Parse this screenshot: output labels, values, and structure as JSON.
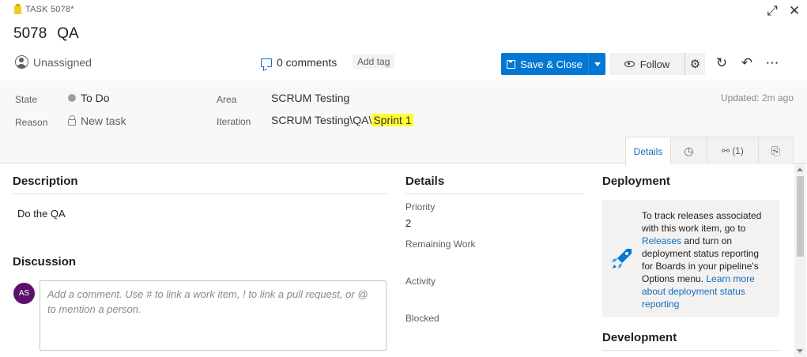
{
  "header": {
    "work_item_type": "TASK 5078*",
    "id": "5078",
    "title": "QA",
    "assignee": "Unassigned",
    "comments_label": "0 comments",
    "add_tag_label": "Add tag",
    "save_label": "Save & Close",
    "follow_label": "Follow",
    "accent_color": "#f2cb1d",
    "icons": [
      "clipboard-icon",
      "expand-icon",
      "close-icon",
      "person-icon",
      "comment-icon",
      "save-icon",
      "chevron-down-icon",
      "eye-icon",
      "gear-icon",
      "refresh-icon",
      "undo-icon",
      "more-icon"
    ]
  },
  "fields": {
    "state_label": "State",
    "state_value": "To Do",
    "reason_label": "Reason",
    "reason_value": "New task",
    "area_label": "Area",
    "area_value": "SCRUM Testing",
    "iteration_label": "Iteration",
    "iteration_prefix": "SCRUM Testing\\QA\\",
    "iteration_sprint": "Sprint 1",
    "updated": "Updated: 2m ago"
  },
  "tabs": {
    "details_label": "Details",
    "links_count": "(1)"
  },
  "description": {
    "title": "Description",
    "text": "Do the QA"
  },
  "discussion": {
    "title": "Discussion",
    "avatar_initials": "AS",
    "avatar_color": "#5c126b",
    "comment_placeholder": "Add a comment. Use # to link a work item, ! to link a pull request, or @ to mention a person."
  },
  "details": {
    "title": "Details",
    "priority_label": "Priority",
    "priority_value": "2",
    "remaining_work_label": "Remaining Work",
    "activity_label": "Activity",
    "blocked_label": "Blocked"
  },
  "deployment": {
    "title": "Deployment",
    "text_1": "To track releases associated with this work item, go to ",
    "releases_link": "Releases",
    "text_2": " and turn on deployment status reporting for Boards in your pipeline's Options menu. ",
    "learn_more_link": "Learn more about deployment status reporting"
  },
  "development": {
    "title": "Development"
  }
}
